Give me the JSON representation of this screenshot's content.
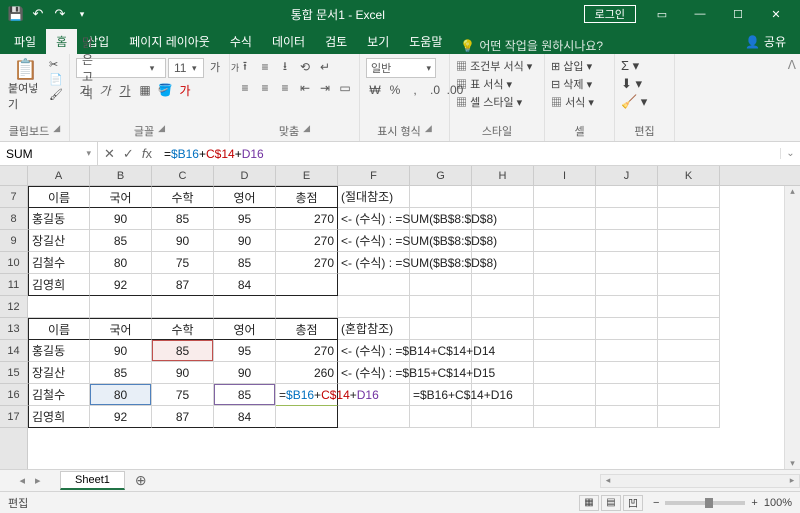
{
  "window": {
    "title": "통합 문서1 - Excel",
    "login": "로그인"
  },
  "tabs": {
    "file": "파일",
    "home": "홈",
    "insert": "삽입",
    "layout": "페이지 레이아웃",
    "formulas": "수식",
    "data": "데이터",
    "review": "검토",
    "view": "보기",
    "help": "도움말",
    "tellme": "어떤 작업을 원하시나요?",
    "share": "공유"
  },
  "ribbon": {
    "clipboard": {
      "paste": "붙여넣기",
      "label": "클립보드"
    },
    "font": {
      "family": "맑은 고딕",
      "size": "11",
      "label": "글꼴"
    },
    "align": {
      "label": "맞춤"
    },
    "number": {
      "format": "일반",
      "label": "표시 형식"
    },
    "styles": {
      "cond": "조건부 서식",
      "tbl": "표 서식",
      "cell": "셀 스타일",
      "label": "스타일"
    },
    "cells": {
      "insert": "삽입",
      "delete": "삭제",
      "format": "서식",
      "label": "셀"
    },
    "editing": {
      "label": "편집"
    }
  },
  "formula_bar": {
    "name": "SUM",
    "parts": [
      "=",
      "$B16",
      "+",
      "C$14",
      "+",
      "D16"
    ]
  },
  "columns": [
    "A",
    "B",
    "C",
    "D",
    "E",
    "F",
    "G",
    "H",
    "I",
    "J",
    "K"
  ],
  "rows": [
    "7",
    "8",
    "9",
    "10",
    "11",
    "12",
    "13",
    "14",
    "15",
    "16",
    "17"
  ],
  "t7": {
    "a": "이름",
    "b": "국어",
    "c": "수학",
    "d": "영어",
    "e": "총점",
    "f": "(절대참조)"
  },
  "t8": {
    "a": "홍길동",
    "b": "90",
    "c": "85",
    "d": "95",
    "e": "270",
    "f": "<- (수식) : =SUM($B$8:$D$8)"
  },
  "t9": {
    "a": "장길산",
    "b": "85",
    "c": "90",
    "d": "90",
    "e": "270",
    "f": "<- (수식) : =SUM($B$8:$D$8)"
  },
  "t10": {
    "a": "김철수",
    "b": "80",
    "c": "75",
    "d": "85",
    "e": "270",
    "f": "<- (수식) : =SUM($B$8:$D$8)"
  },
  "t11": {
    "a": "김영희",
    "b": "92",
    "c": "87",
    "d": "84"
  },
  "t13": {
    "a": "이름",
    "b": "국어",
    "c": "수학",
    "d": "영어",
    "e": "총점",
    "f": "(혼합참조)"
  },
  "t14": {
    "a": "홍길동",
    "b": "90",
    "c": "85",
    "d": "95",
    "e": "270",
    "f": "<- (수식) : =$B14+C$14+D14"
  },
  "t15": {
    "a": "장길산",
    "b": "85",
    "c": "90",
    "d": "90",
    "e": "260",
    "f": "<- (수식) : =$B15+C$14+D15"
  },
  "t16": {
    "a": "김철수",
    "b": "80",
    "c": "75",
    "d": "85",
    "g": "=$B16+C$14+D16"
  },
  "t16e": {
    "p1": "=",
    "p2": "$B16",
    "p3": "+",
    "p4": "C$14",
    "p5": "+",
    "p6": "D16"
  },
  "t17": {
    "a": "김영희",
    "b": "92",
    "c": "87",
    "d": "84"
  },
  "sheet": {
    "name": "Sheet1"
  },
  "status": {
    "mode": "편집",
    "zoom": "100%"
  }
}
